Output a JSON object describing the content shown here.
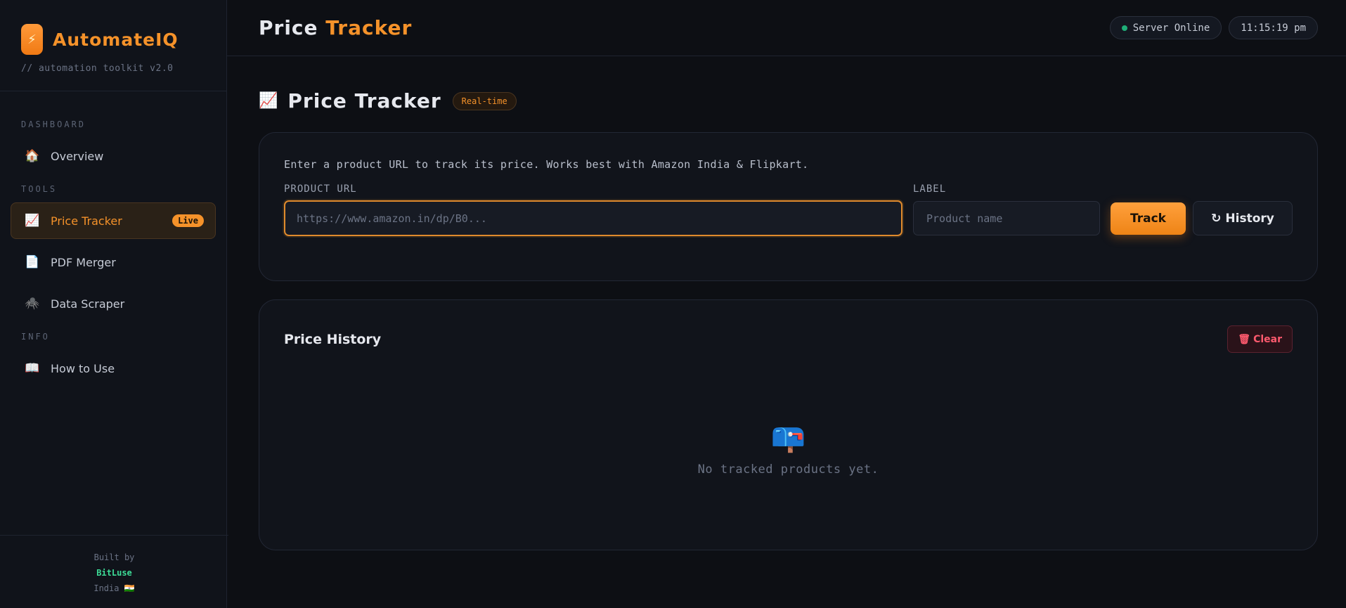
{
  "brand": {
    "name": "AutomateIQ",
    "subtitle": "// automation toolkit v2.0",
    "logo_glyph": "⚡"
  },
  "sidebar": {
    "sections": {
      "dashboard": "DASHBOARD",
      "tools": "TOOLS",
      "info": "INFO"
    },
    "items": [
      {
        "label": "Overview",
        "icon": "🏠"
      },
      {
        "label": "Price Tracker",
        "icon": "📈",
        "badge": "Live"
      },
      {
        "label": "PDF Merger",
        "icon": "📄"
      },
      {
        "label": "Data Scraper",
        "icon": "🕷️"
      },
      {
        "label": "How to Use",
        "icon": "📖"
      }
    ],
    "footer": {
      "built_by": "Built by",
      "author": "BitLuse",
      "country": "India 🇮🇳"
    }
  },
  "topbar": {
    "title_main": "Price ",
    "title_accent": "Tracker",
    "status": "Server Online",
    "clock": "11:15:19 pm"
  },
  "page": {
    "icon": "📈",
    "title": "Price Tracker",
    "badge": "Real-time"
  },
  "form": {
    "intro": "Enter a product URL to track its price. Works best with Amazon India & Flipkart.",
    "url_label": "PRODUCT URL",
    "url_placeholder": "https://www.amazon.in/dp/B0...",
    "label_label": "LABEL",
    "label_placeholder": "Product name",
    "track_button": "Track",
    "history_button": "History",
    "history_icon": "↻"
  },
  "history": {
    "title": "Price History",
    "clear_icon": "🗑",
    "clear_button": "Clear",
    "empty_icon": "📪",
    "empty_message": "No tracked products yet."
  },
  "colors": {
    "accent": "#f5922a",
    "status_online": "#1fae78",
    "danger": "#ff5a6e",
    "author": "#3ddc97"
  }
}
